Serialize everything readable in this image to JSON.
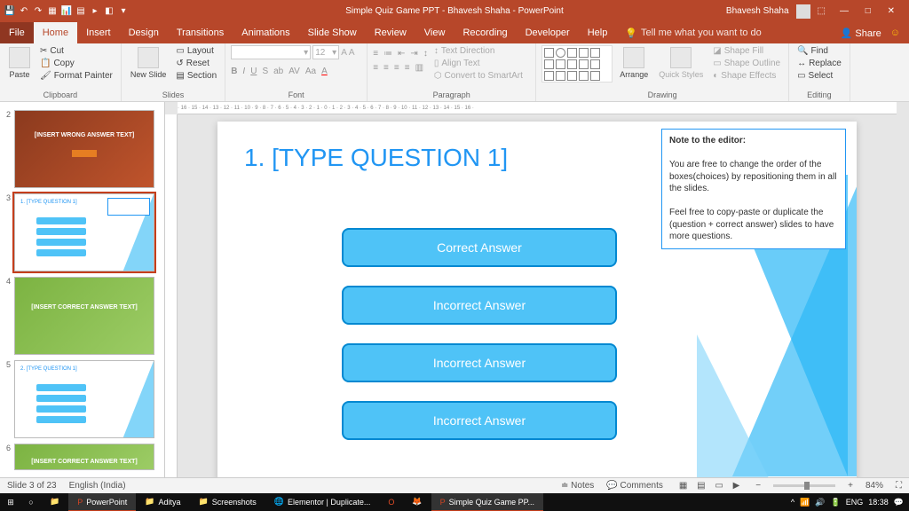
{
  "title_bar": {
    "document_title": "Simple Quiz Game PPT - Bhavesh Shaha - PowerPoint",
    "user_name": "Bhavesh Shaha"
  },
  "tabs": {
    "file": "File",
    "home": "Home",
    "insert": "Insert",
    "design": "Design",
    "transitions": "Transitions",
    "animations": "Animations",
    "slide_show": "Slide Show",
    "review": "Review",
    "view": "View",
    "recording": "Recording",
    "developer": "Developer",
    "help": "Help",
    "tell_me": "Tell me what you want to do",
    "share": "Share"
  },
  "ribbon": {
    "clipboard": {
      "label": "Clipboard",
      "paste": "Paste",
      "cut": "Cut",
      "copy": "Copy",
      "format_painter": "Format Painter"
    },
    "slides": {
      "label": "Slides",
      "new_slide": "New Slide",
      "layout": "Layout",
      "reset": "Reset",
      "section": "Section"
    },
    "font": {
      "label": "Font",
      "size": "12"
    },
    "paragraph": {
      "label": "Paragraph",
      "text_direction": "Text Direction",
      "align_text": "Align Text",
      "smartart": "Convert to SmartArt"
    },
    "drawing": {
      "label": "Drawing",
      "arrange": "Arrange",
      "quick_styles": "Quick Styles",
      "shape_fill": "Shape Fill",
      "shape_outline": "Shape Outline",
      "shape_effects": "Shape Effects"
    },
    "editing": {
      "label": "Editing",
      "find": "Find",
      "replace": "Replace",
      "select": "Select"
    }
  },
  "thumbnails": [
    {
      "num": "2",
      "bg": "#8B3A1E",
      "text": "[INSERT WRONG ANSWER TEXT]"
    },
    {
      "num": "3",
      "bg": "#ffffff",
      "text": "",
      "selected": true
    },
    {
      "num": "4",
      "bg": "#7CB342",
      "text": "[INSERT CORRECT ANSWER TEXT]"
    },
    {
      "num": "5",
      "bg": "#ffffff",
      "text": ""
    },
    {
      "num": "6",
      "bg": "#7CB342",
      "text": "[INSERT CORRECT ANSWER TEXT]"
    }
  ],
  "slide": {
    "title": "1. [TYPE QUESTION 1]",
    "choices": [
      "Correct Answer",
      "Incorrect Answer",
      "Incorrect Answer",
      "Incorrect Answer"
    ],
    "note_title": "Note to the editor:",
    "note_p1": "You are free to change the order of the boxes(choices) by repositioning them in all the slides.",
    "note_p2": "Feel free to copy-paste or duplicate the (question + correct answer) slides to have more questions."
  },
  "status": {
    "slide_count": "Slide 3 of 23",
    "language": "English (India)",
    "notes": "Notes",
    "comments": "Comments",
    "zoom": "84%"
  },
  "taskbar": {
    "items": [
      "PowerPoint",
      "Aditya",
      "Screenshots",
      "Elementor | Duplicate...",
      "",
      "",
      "Simple Quiz Game PP..."
    ],
    "lang": "ENG",
    "time": "18:38"
  }
}
